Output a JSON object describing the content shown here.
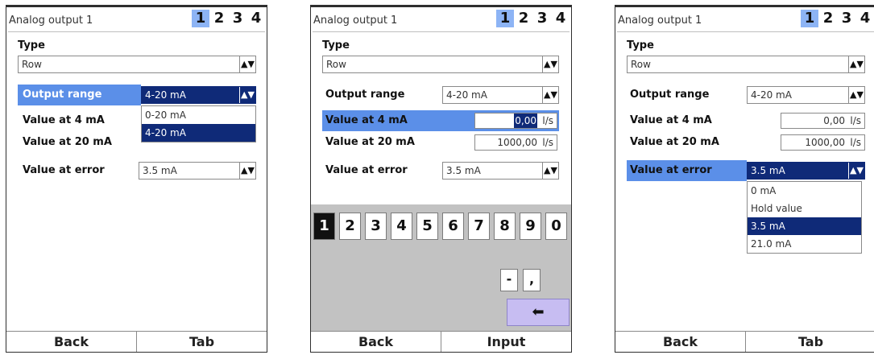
{
  "screens": [
    {
      "title": "Analog output 1",
      "tabs": [
        "1",
        "2",
        "3",
        "4"
      ],
      "active_tab": "1",
      "type_label": "Type",
      "type_value": "Row",
      "output_range_label": "Output range",
      "output_range_value": "4-20 mA",
      "output_range_options": [
        "0-20 mA",
        "4-20 mA"
      ],
      "value4_label": "Value at 4 mA",
      "value20_label": "Value at 20 mA",
      "error_label": "Value at error",
      "error_value": "3.5 mA",
      "buttons": [
        "Back",
        "Tab"
      ]
    },
    {
      "title": "Analog output 1",
      "tabs": [
        "1",
        "2",
        "3",
        "4"
      ],
      "active_tab": "1",
      "type_label": "Type",
      "type_value": "Row",
      "output_range_label": "Output range",
      "output_range_value": "4-20 mA",
      "value4_label": "Value at 4 mA",
      "value4": "0,00",
      "value4_unit": "l/s",
      "value20_label": "Value at 20 mA",
      "value20": "1000,00",
      "value20_unit": "l/s",
      "error_label": "Value at error",
      "error_value": "3.5 mA",
      "keypad_digits": [
        "1",
        "2",
        "3",
        "4",
        "5",
        "6",
        "7",
        "8",
        "9",
        "0"
      ],
      "keypad_minus": "-",
      "keypad_comma": ",",
      "keypad_enter": "⬅",
      "buttons": [
        "Back",
        "Input"
      ]
    },
    {
      "title": "Analog output 1",
      "tabs": [
        "1",
        "2",
        "3",
        "4"
      ],
      "active_tab": "1",
      "type_label": "Type",
      "type_value": "Row",
      "output_range_label": "Output range",
      "output_range_value": "4-20 mA",
      "value4_label": "Value at 4 mA",
      "value4": "0,00",
      "value4_unit": "l/s",
      "value20_label": "Value at 20 mA",
      "value20": "1000,00",
      "value20_unit": "l/s",
      "error_label": "Value at error",
      "error_value": "3.5 mA",
      "error_options": [
        "0 mA",
        "Hold value",
        "3.5 mA",
        "21.0 mA"
      ],
      "buttons": [
        "Back",
        "Tab"
      ]
    }
  ],
  "colors": {
    "row_highlight": "#5b8fe8",
    "selection_dark": "#0f2a78",
    "tab_active": "#8db4f5",
    "keypad_bg": "#c2c2c2",
    "enter_key": "#c7bdf2"
  }
}
